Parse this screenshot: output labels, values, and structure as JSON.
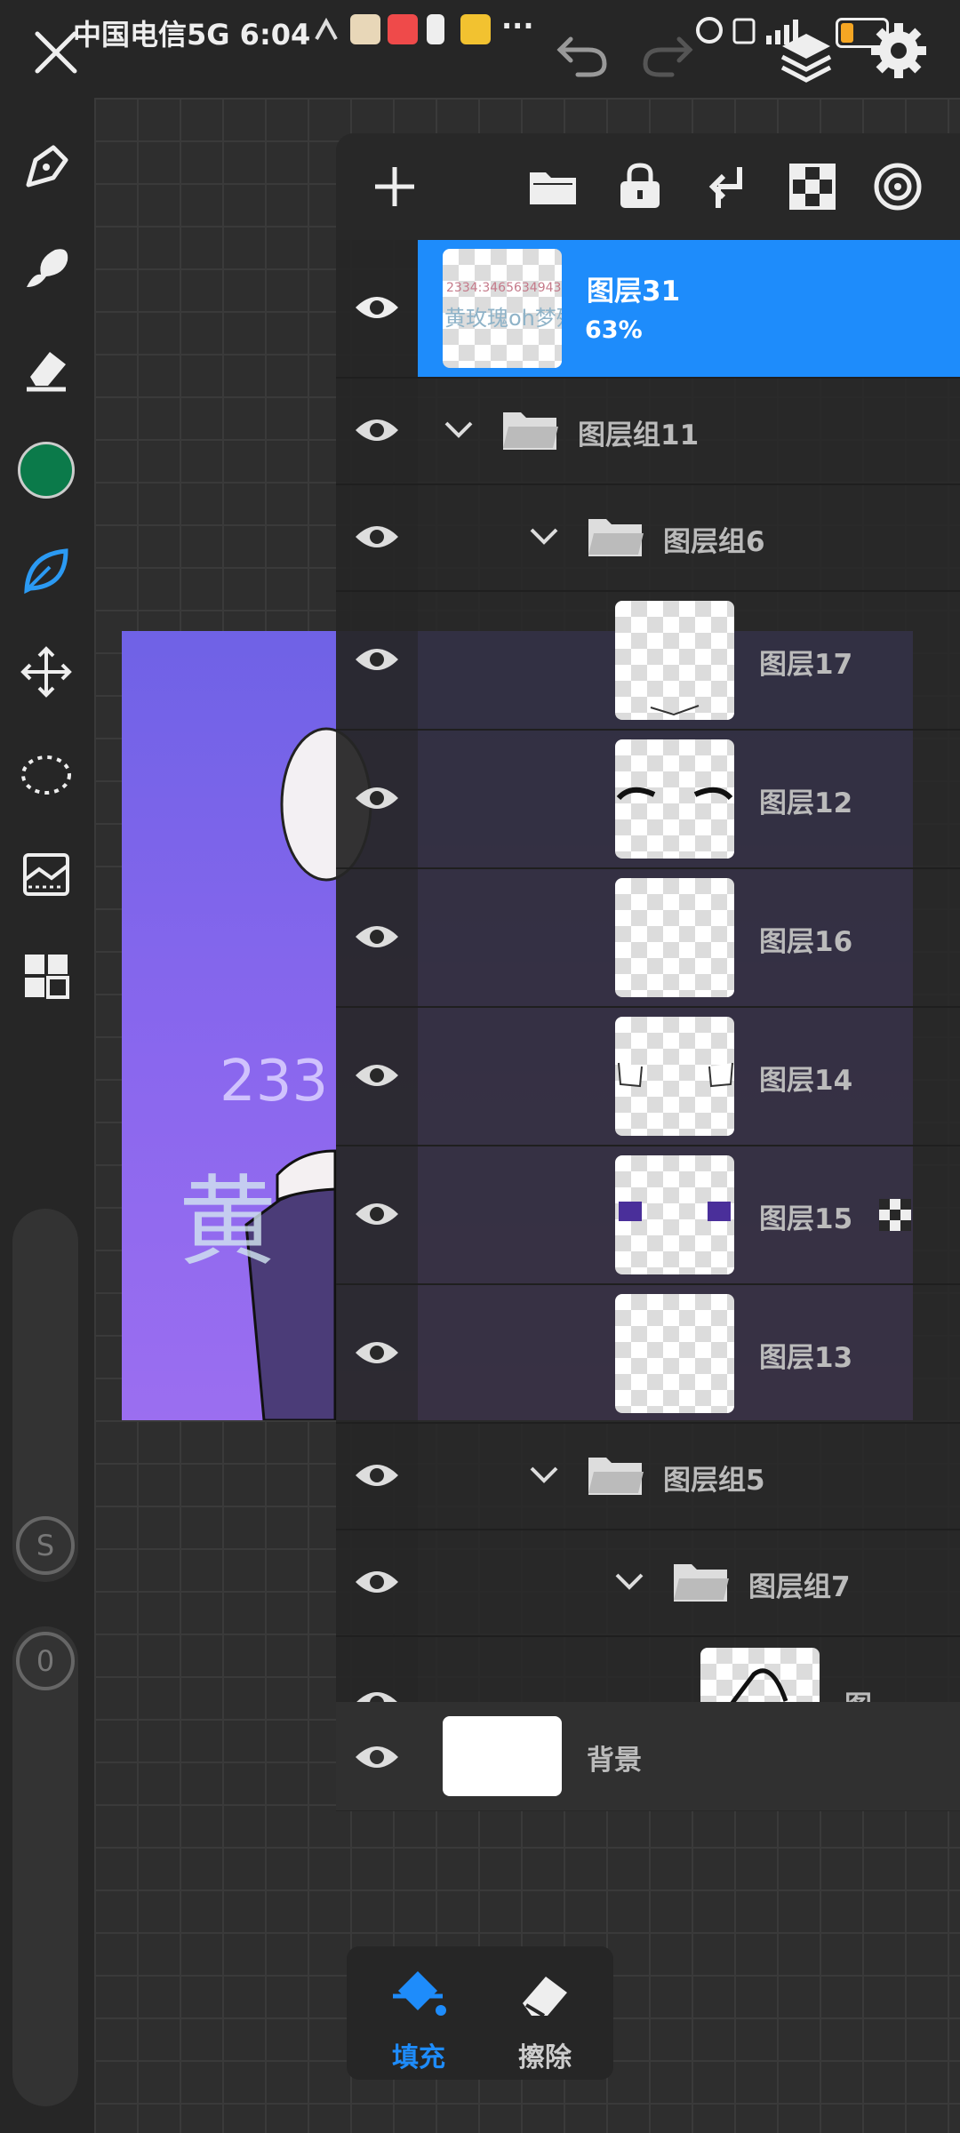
{
  "status_bar": {
    "carrier_time": "中国电信5G 6:04",
    "more": "···"
  },
  "top_bar": {
    "close_icon": "close-icon",
    "undo_icon": "undo-icon",
    "redo_icon": "redo-icon",
    "layers_icon": "layers-icon",
    "settings_icon": "gear-icon"
  },
  "left_toolbar": {
    "current_color": "#0b7a4a",
    "slider_size_label": "S",
    "slider_opacity_label": "0"
  },
  "canvas": {
    "line1": "233",
    "line2": "黄"
  },
  "layers_panel": {
    "accent": "#1e8cfb",
    "layers": [
      {
        "name": "图层31",
        "opacity": "63%",
        "selected": true,
        "thumb_text1": "2334:3465634943",
        "thumb_text2": "黄玫瑰oh梦殇"
      },
      {
        "name": "图层组11",
        "type": "group"
      },
      {
        "name": "图层组6",
        "type": "group"
      },
      {
        "name": "图层17"
      },
      {
        "name": "图层12"
      },
      {
        "name": "图层16"
      },
      {
        "name": "图层14"
      },
      {
        "name": "图层15"
      },
      {
        "name": "图层13"
      },
      {
        "name": "图层组5",
        "type": "group"
      },
      {
        "name": "图层组7",
        "type": "group"
      },
      {
        "name": "图"
      }
    ],
    "background_layer": "背景"
  },
  "bottom_tools": {
    "fill_label": "填充",
    "erase_label": "擦除"
  }
}
